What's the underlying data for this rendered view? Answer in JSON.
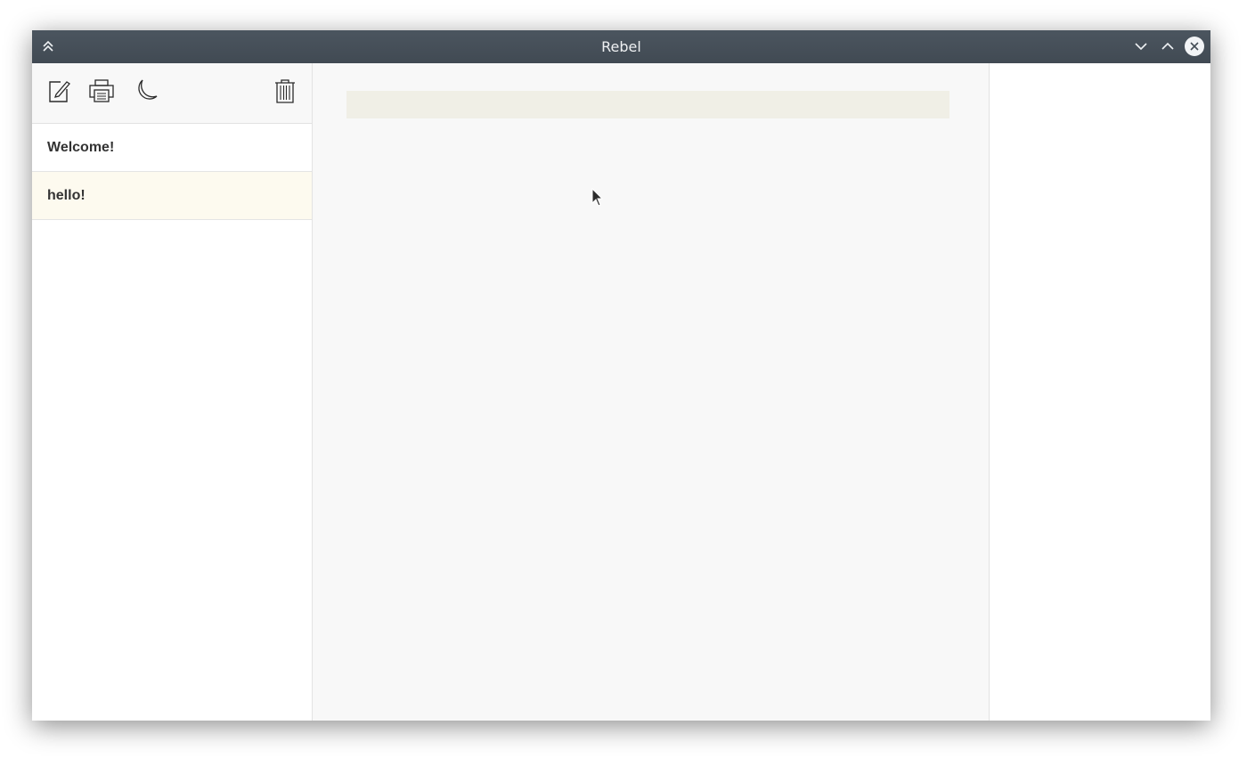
{
  "window": {
    "title": "Rebel"
  },
  "titlebar": {
    "icons": [
      "shade-up-icon",
      "minimize-chevron-down-icon",
      "maximize-chevron-up-icon",
      "close-icon"
    ]
  },
  "toolbar": {
    "tools": [
      "new-note-icon",
      "print-icon",
      "night-mode-moon-icon",
      "trash-icon"
    ]
  },
  "notes": [
    {
      "title": "Welcome!"
    },
    {
      "title": "hello!",
      "active": true
    }
  ],
  "editor": {
    "title_value": "",
    "title_placeholder": ""
  },
  "colors": {
    "titlebar": "#474f58",
    "active_note": "#fdfaef",
    "editor_bg": "#f8f8f8",
    "title_field": "#f0efe6"
  }
}
